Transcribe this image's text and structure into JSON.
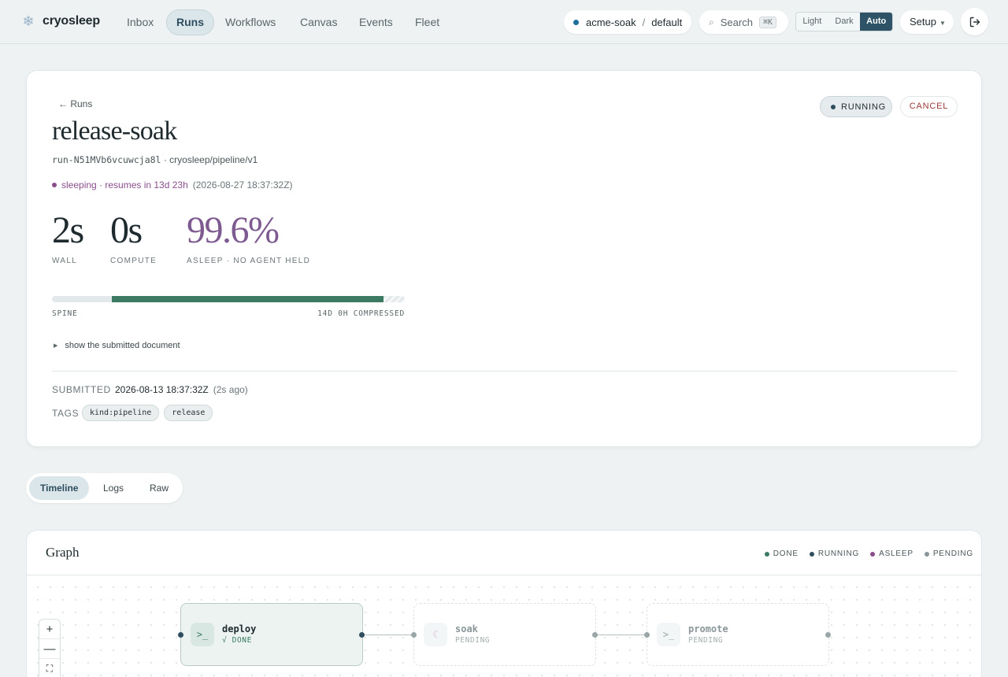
{
  "nav": {
    "brand": "cryosleep",
    "links": [
      {
        "label": "Inbox",
        "active": false
      },
      {
        "label": "Runs",
        "active": true
      },
      {
        "label": "Workflows",
        "active": false
      },
      {
        "label": "Canvas",
        "active": false
      },
      {
        "label": "Events",
        "active": false
      },
      {
        "label": "Fleet",
        "active": false
      }
    ],
    "workspace": {
      "org": "acme-soak",
      "sep": "/",
      "env": "default"
    },
    "search": {
      "label": "Search",
      "shortcut": "⌘K"
    },
    "theme": {
      "options": [
        "Light",
        "Dark",
        "Auto"
      ],
      "selected": "Auto"
    },
    "setup_label": "Setup",
    "setup_caret": "▼"
  },
  "run": {
    "back_label": "Runs",
    "title": "release-soak",
    "id": "run-N51MVb6vcuwcja8l",
    "pipeline": "cryosleep/pipeline/v1",
    "status": "RUNNING",
    "cancel_label": "CANCEL",
    "sleep_text": "sleeping · resumes in 13d 23h",
    "sleep_timestamp": "(2026-08-27 18:37:32Z)",
    "stats": [
      {
        "value": "2s",
        "label": "WALL"
      },
      {
        "value": "0s",
        "label": "COMPUTE"
      },
      {
        "value": "99.6%",
        "label": "ASLEEP · NO AGENT HELD"
      }
    ],
    "spine": {
      "left_label": "SPINE",
      "right_label": "14D 0H COMPRESSED",
      "segments": {
        "idle_start_fraction": 0.17,
        "active_fraction": 0.77,
        "compressed_fraction": 0.06
      }
    },
    "disclosure_label": "show the submitted document",
    "submitted": {
      "key": "SUBMITTED",
      "value": "2026-08-13 18:37:32Z",
      "relative": "(2s ago)"
    },
    "tags": {
      "key": "TAGS",
      "items": [
        "kind:pipeline",
        "release"
      ]
    }
  },
  "tabs": {
    "items": [
      {
        "label": "Timeline",
        "active": true
      },
      {
        "label": "Logs",
        "active": false
      },
      {
        "label": "Raw",
        "active": false
      }
    ]
  },
  "graph": {
    "title": "Graph",
    "legend": [
      {
        "label": "DONE",
        "color": "#3c7a63"
      },
      {
        "label": "RUNNING",
        "color": "#2e4e5f"
      },
      {
        "label": "ASLEEP",
        "color": "#8a4e8c"
      },
      {
        "label": "PENDING",
        "color": "#8a9699"
      }
    ],
    "zoom": {
      "in": "+",
      "out": "—",
      "fit": "⛶"
    },
    "nodes": [
      {
        "name": "deploy",
        "state": "√ DONE",
        "icon": "terminal-icon",
        "glyph": ">_"
      },
      {
        "name": "soak",
        "state": "PENDING",
        "icon": "moon-icon",
        "glyph": "☾"
      },
      {
        "name": "promote",
        "state": "PENDING",
        "icon": "terminal-icon",
        "glyph": ">_"
      }
    ]
  },
  "colors": {
    "accent": "#2e5266",
    "done": "#3c7a63",
    "asleep": "#8a4e8c",
    "danger": "#9b3a3a"
  }
}
